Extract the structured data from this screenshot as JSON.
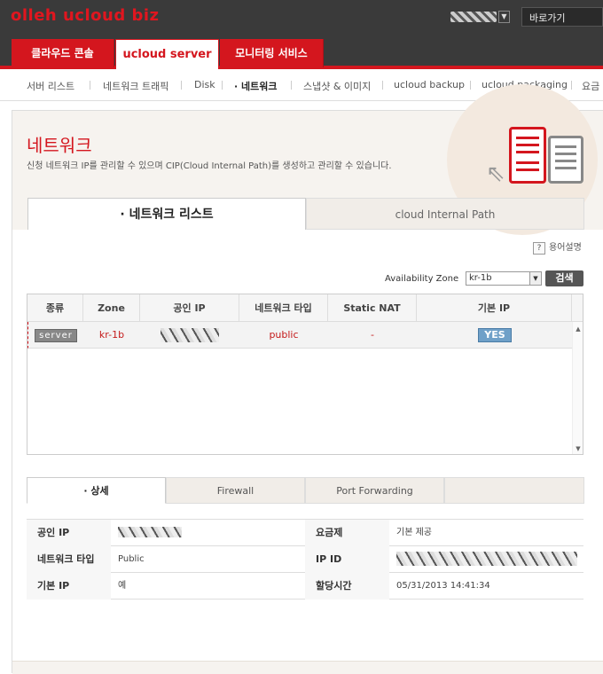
{
  "brand": "olleh ucloud biz",
  "header": {
    "goto_label": "바로가기"
  },
  "main_tabs": [
    {
      "label": "클라우드 콘솔"
    },
    {
      "label": "ucloud server"
    },
    {
      "label": "모니터링 서비스"
    }
  ],
  "sub_nav": [
    {
      "label": "서버 리스트"
    },
    {
      "label": "네트워크 트래픽"
    },
    {
      "label": "Disk"
    },
    {
      "label": "· 네트워크"
    },
    {
      "label": "스냅샷 & 이미지"
    },
    {
      "label": "ucloud backup"
    },
    {
      "label": "ucloud packaging"
    },
    {
      "label": "요금"
    }
  ],
  "page": {
    "title": "네트워크",
    "description": "신청 네트워크 IP를 관리할 수 있으며 CIP(Cloud Internal Path)를 생성하고 관리할 수 있습니다."
  },
  "section_tabs": [
    {
      "label": "· 네트워크 리스트"
    },
    {
      "label": "cloud Internal Path"
    }
  ],
  "help_label": "용어설명",
  "filter": {
    "zone_label": "Availability Zone",
    "zone_value": "kr-1b",
    "search_label": "검색"
  },
  "table": {
    "columns": [
      "종류",
      "Zone",
      "공인 IP",
      "네트워크 타입",
      "Static NAT",
      "기본 IP"
    ],
    "rows": [
      {
        "type": "server",
        "zone": "kr-1b",
        "network_type": "public",
        "static_nat": "-",
        "default_ip": "YES"
      }
    ]
  },
  "detail_tabs": [
    {
      "label": "· 상세"
    },
    {
      "label": "Firewall"
    },
    {
      "label": "Port Forwarding"
    }
  ],
  "details": {
    "public_ip_label": "공인 IP",
    "rate_plan_label": "요금제",
    "rate_plan_value": "기본 제공",
    "network_type_label": "네트워크 타입",
    "network_type_value": "Public",
    "ip_id_label": "IP ID",
    "default_ip_label": "기본 IP",
    "default_ip_value": "예",
    "assigned_time_label": "할당시간",
    "assigned_time_value": "05/31/2013 14:41:34"
  }
}
